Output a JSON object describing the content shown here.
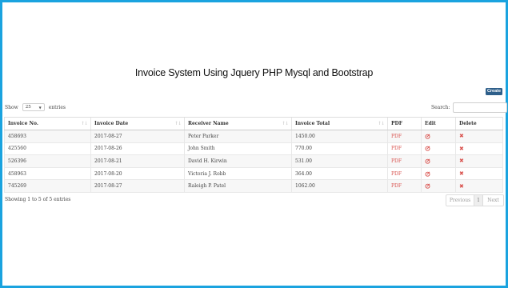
{
  "page": {
    "title": "Invoice System Using Jquery PHP Mysql and Bootstrap",
    "create_label": "Create"
  },
  "length": {
    "show_label": "Show",
    "value": "25",
    "entries_label": "entries"
  },
  "search": {
    "label": "Search:",
    "value": ""
  },
  "table": {
    "headers": [
      "Invoice No.",
      "Invoice Date",
      "Receiver Name",
      "Invoice Total",
      "PDF",
      "Edit",
      "Delete"
    ],
    "rows": [
      {
        "invoice_no": "458693",
        "date": "2017-08-27",
        "receiver": "Peter Parker",
        "total": "1450.00",
        "pdf": "PDF"
      },
      {
        "invoice_no": "425560",
        "date": "2017-08-26",
        "receiver": "John Smith",
        "total": "770.00",
        "pdf": "PDF"
      },
      {
        "invoice_no": "526396",
        "date": "2017-08-21",
        "receiver": "David H. Kirwin",
        "total": "531.00",
        "pdf": "PDF"
      },
      {
        "invoice_no": "458963",
        "date": "2017-08-20",
        "receiver": "Victoria J. Robb",
        "total": "364.00",
        "pdf": "PDF"
      },
      {
        "invoice_no": "745269",
        "date": "2017-08-27",
        "receiver": "Raleigh P. Patel",
        "total": "1062.00",
        "pdf": "PDF"
      }
    ]
  },
  "footer": {
    "info": "Showing 1 to 5 of 5 entries",
    "prev_label": "Previous",
    "page_number": "1",
    "next_label": "Next"
  },
  "icons": {
    "edit": "edit-icon",
    "delete": "delete-icon",
    "sort": "sort-icon"
  },
  "colors": {
    "frame": "#1aa3df",
    "create_button": "#2e5f8a",
    "action_red": "#d9534f"
  }
}
